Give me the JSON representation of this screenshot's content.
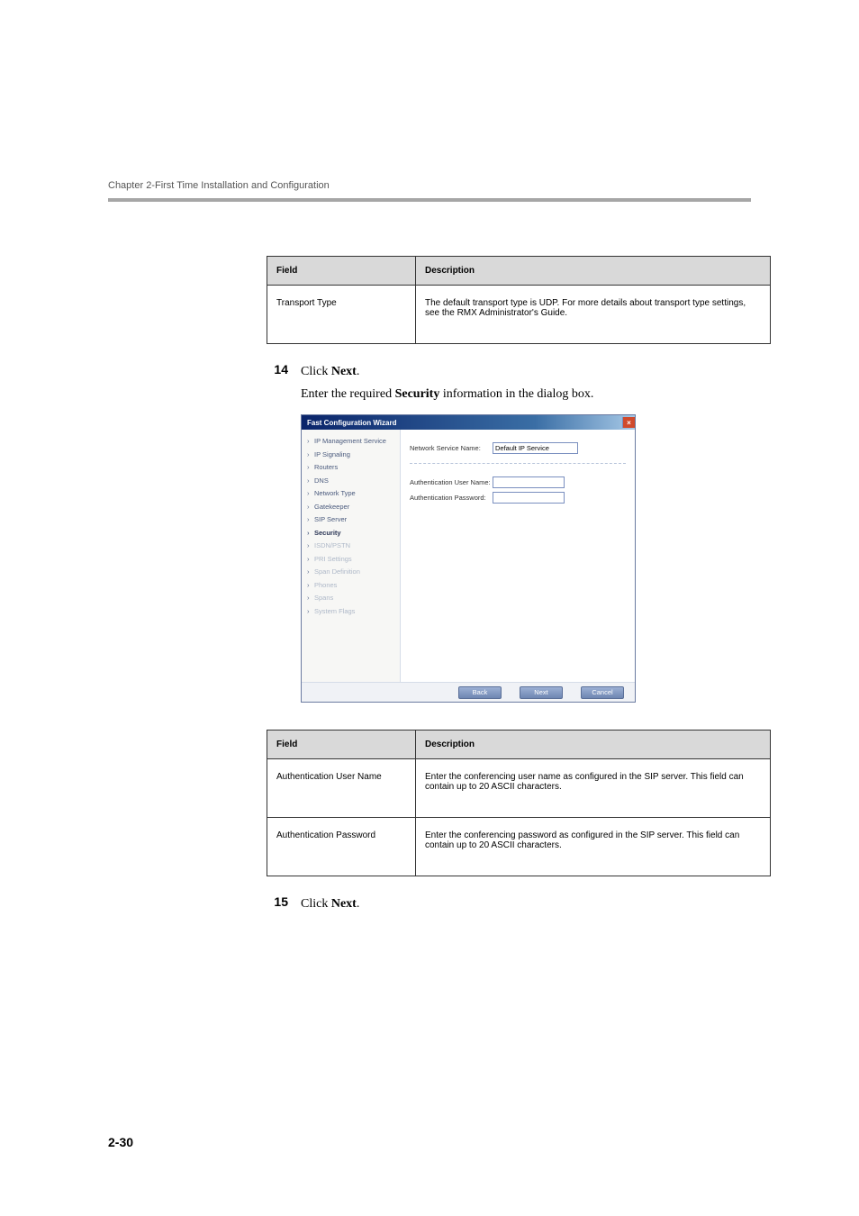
{
  "header": {
    "chapter_line": "Chapter 2-First Time Installation and Configuration"
  },
  "table1": {
    "head_field": "Field",
    "head_desc": "Description",
    "row1_field": "Transport Type",
    "row1_desc": "The default transport type is UDP. For more details about transport type settings, see the RMX Administrator's Guide."
  },
  "step14": {
    "num": "14",
    "action_prefix": "Click ",
    "action_bold": "Next",
    "action_suffix": ".",
    "desc_prefix": "Enter the required ",
    "desc_bold": "Security",
    "desc_suffix": " information in the dialog box."
  },
  "wizard": {
    "title": "Fast Configuration Wizard",
    "close_glyph": "×",
    "sidebar": {
      "items": [
        {
          "label": "IP Management Service",
          "state": "done"
        },
        {
          "label": "IP Signaling",
          "state": "done"
        },
        {
          "label": "Routers",
          "state": "done"
        },
        {
          "label": "DNS",
          "state": "done"
        },
        {
          "label": "Network Type",
          "state": "done"
        },
        {
          "label": "Gatekeeper",
          "state": "done"
        },
        {
          "label": "SIP Server",
          "state": "done"
        },
        {
          "label": "Security",
          "state": "current"
        },
        {
          "label": "ISDN/PSTN",
          "state": "disabled"
        },
        {
          "label": "PRI Settings",
          "state": "disabled"
        },
        {
          "label": "Span Definition",
          "state": "disabled"
        },
        {
          "label": "Phones",
          "state": "disabled"
        },
        {
          "label": "Spans",
          "state": "disabled"
        },
        {
          "label": "System Flags",
          "state": "disabled"
        }
      ]
    },
    "form": {
      "network_service_name_label": "Network Service Name:",
      "network_service_name_value": "Default IP Service",
      "auth_user_label": "Authentication User Name:",
      "auth_user_value": "",
      "auth_pwd_label": "Authentication Password:",
      "auth_pwd_value": ""
    },
    "buttons": {
      "back": "Back",
      "next": "Next",
      "cancel": "Cancel"
    }
  },
  "table2": {
    "head_field": "Field",
    "head_desc": "Description",
    "row1_field": "Authentication User Name",
    "row1_desc": "Enter the conferencing user name as configured in the SIP server. This field can contain up to 20 ASCII characters.",
    "row2_field": "Authentication Password",
    "row2_desc": "Enter the conferencing password as configured in the SIP server. This field can contain up to 20 ASCII characters."
  },
  "step15": {
    "num": "15",
    "action_prefix": "Click ",
    "action_bold": "Next",
    "action_suffix": "."
  },
  "page_number": "2-30"
}
